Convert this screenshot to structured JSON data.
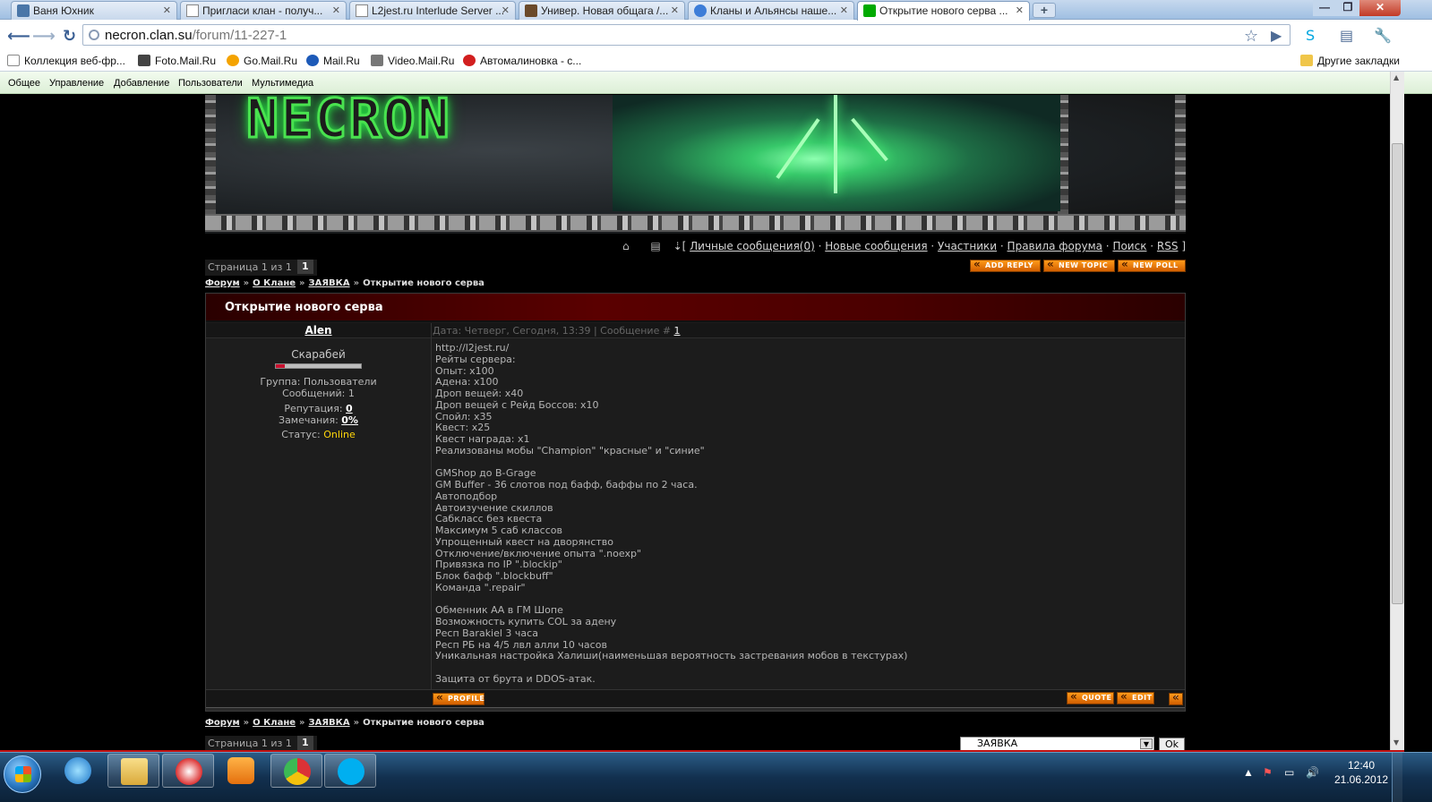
{
  "browser": {
    "tabs": [
      {
        "title": "Ваня Юхник",
        "active": false
      },
      {
        "title": "Пригласи клан - получ...",
        "active": false
      },
      {
        "title": "L2jest.ru Interlude Server ...",
        "active": false
      },
      {
        "title": "Универ. Новая общага /...",
        "active": false
      },
      {
        "title": "Кланы и Альянсы наше...",
        "active": false
      },
      {
        "title": "Открытие нового серва ...",
        "active": true
      }
    ],
    "url_host": "necron.clan.su",
    "url_path": "/forum/11-227-1",
    "bookmarks": [
      "Коллекция веб-фр...",
      "Foto.Mail.Ru",
      "Go.Mail.Ru",
      "Mail.Ru",
      "Video.Mail.Ru",
      "Автомалиновка - с..."
    ],
    "other_bookmarks": "Другие закладки"
  },
  "ucoz_menu": [
    "Общее",
    "Управление",
    "Добавление",
    "Пользователи",
    "Мультимедиа"
  ],
  "site": {
    "logo_text": "NECRON",
    "user_links": [
      "Личные сообщения(0)",
      "Новые сообщения",
      "Участники",
      "Правила форума",
      "Поиск",
      "RSS"
    ],
    "pager_label": "Страница 1 из 1",
    "pager_current": "1",
    "buttons": {
      "add_reply": "ADD REPLY",
      "new_topic": "NEW TOPIC",
      "new_poll": "NEW POLL",
      "profile": "PROFILE",
      "quote": "QUOTE",
      "edit": "EDIT"
    },
    "breadcrumbs": {
      "forum": "Форум",
      "section": "О Клане",
      "subsection": "ЗАЯВКА",
      "current": "Открытие нового серва"
    },
    "jump_select": "ЗАЯВКА",
    "jump_ok": "Ok"
  },
  "topic": {
    "title": "Открытие нового серва",
    "author": "Alen",
    "post_date": "Дата: Четверг, Сегодня, 13:39 | Сообщение #",
    "post_number": "1",
    "rank": "Скарабей",
    "rank_progress": 0.1,
    "group": "Группа: Пользователи",
    "messages": "Сообщений: 1",
    "reputation_label": "Репутация:",
    "reputation_value": "0",
    "warnings_label": "Замечания:",
    "warnings_value": "0%",
    "status_label": "Статус:",
    "status_value": "Online",
    "body": [
      "http://l2jest.ru/",
      "Рейты сервера:",
      "Опыт: x100",
      "Адена: x100",
      "Дроп вещей: x40",
      "Дроп вещей с Рейд Боссов: x10",
      "Спойл: x35",
      "Квест: x25",
      "Квест награда: x1",
      "Реализованы мобы \"Champion\" \"красные\" и \"синие\"",
      "",
      "GMShop до B-Grage",
      "GM Buffer - 36 слотов под бафф, баффы по 2 часа.",
      "Автоподбор",
      "Автоизучение скиллов",
      "Сабкласс без квеста",
      "Максимум 5 саб классов",
      "Упрощенный квест на дворянство",
      "Отключение/включение опыта \".noexp\"",
      "Привязка по IP \".blockip\"",
      "Блок бафф \".blockbuff\"",
      "Команда \".repair\"",
      "",
      "Обменник АА в ГМ Шопе",
      "Возможность купить COL за адену",
      "Респ Barakiel 3 часа",
      "Респ РБ на 4/5 лвл алли 10 часов",
      "Уникальная настройка Халиши(наименьшая вероятность застревания мобов в текстурах)",
      "",
      "Защита от брута и DDOS-атак."
    ]
  },
  "taskbar": {
    "time": "12:40",
    "date": "21.06.2012"
  }
}
